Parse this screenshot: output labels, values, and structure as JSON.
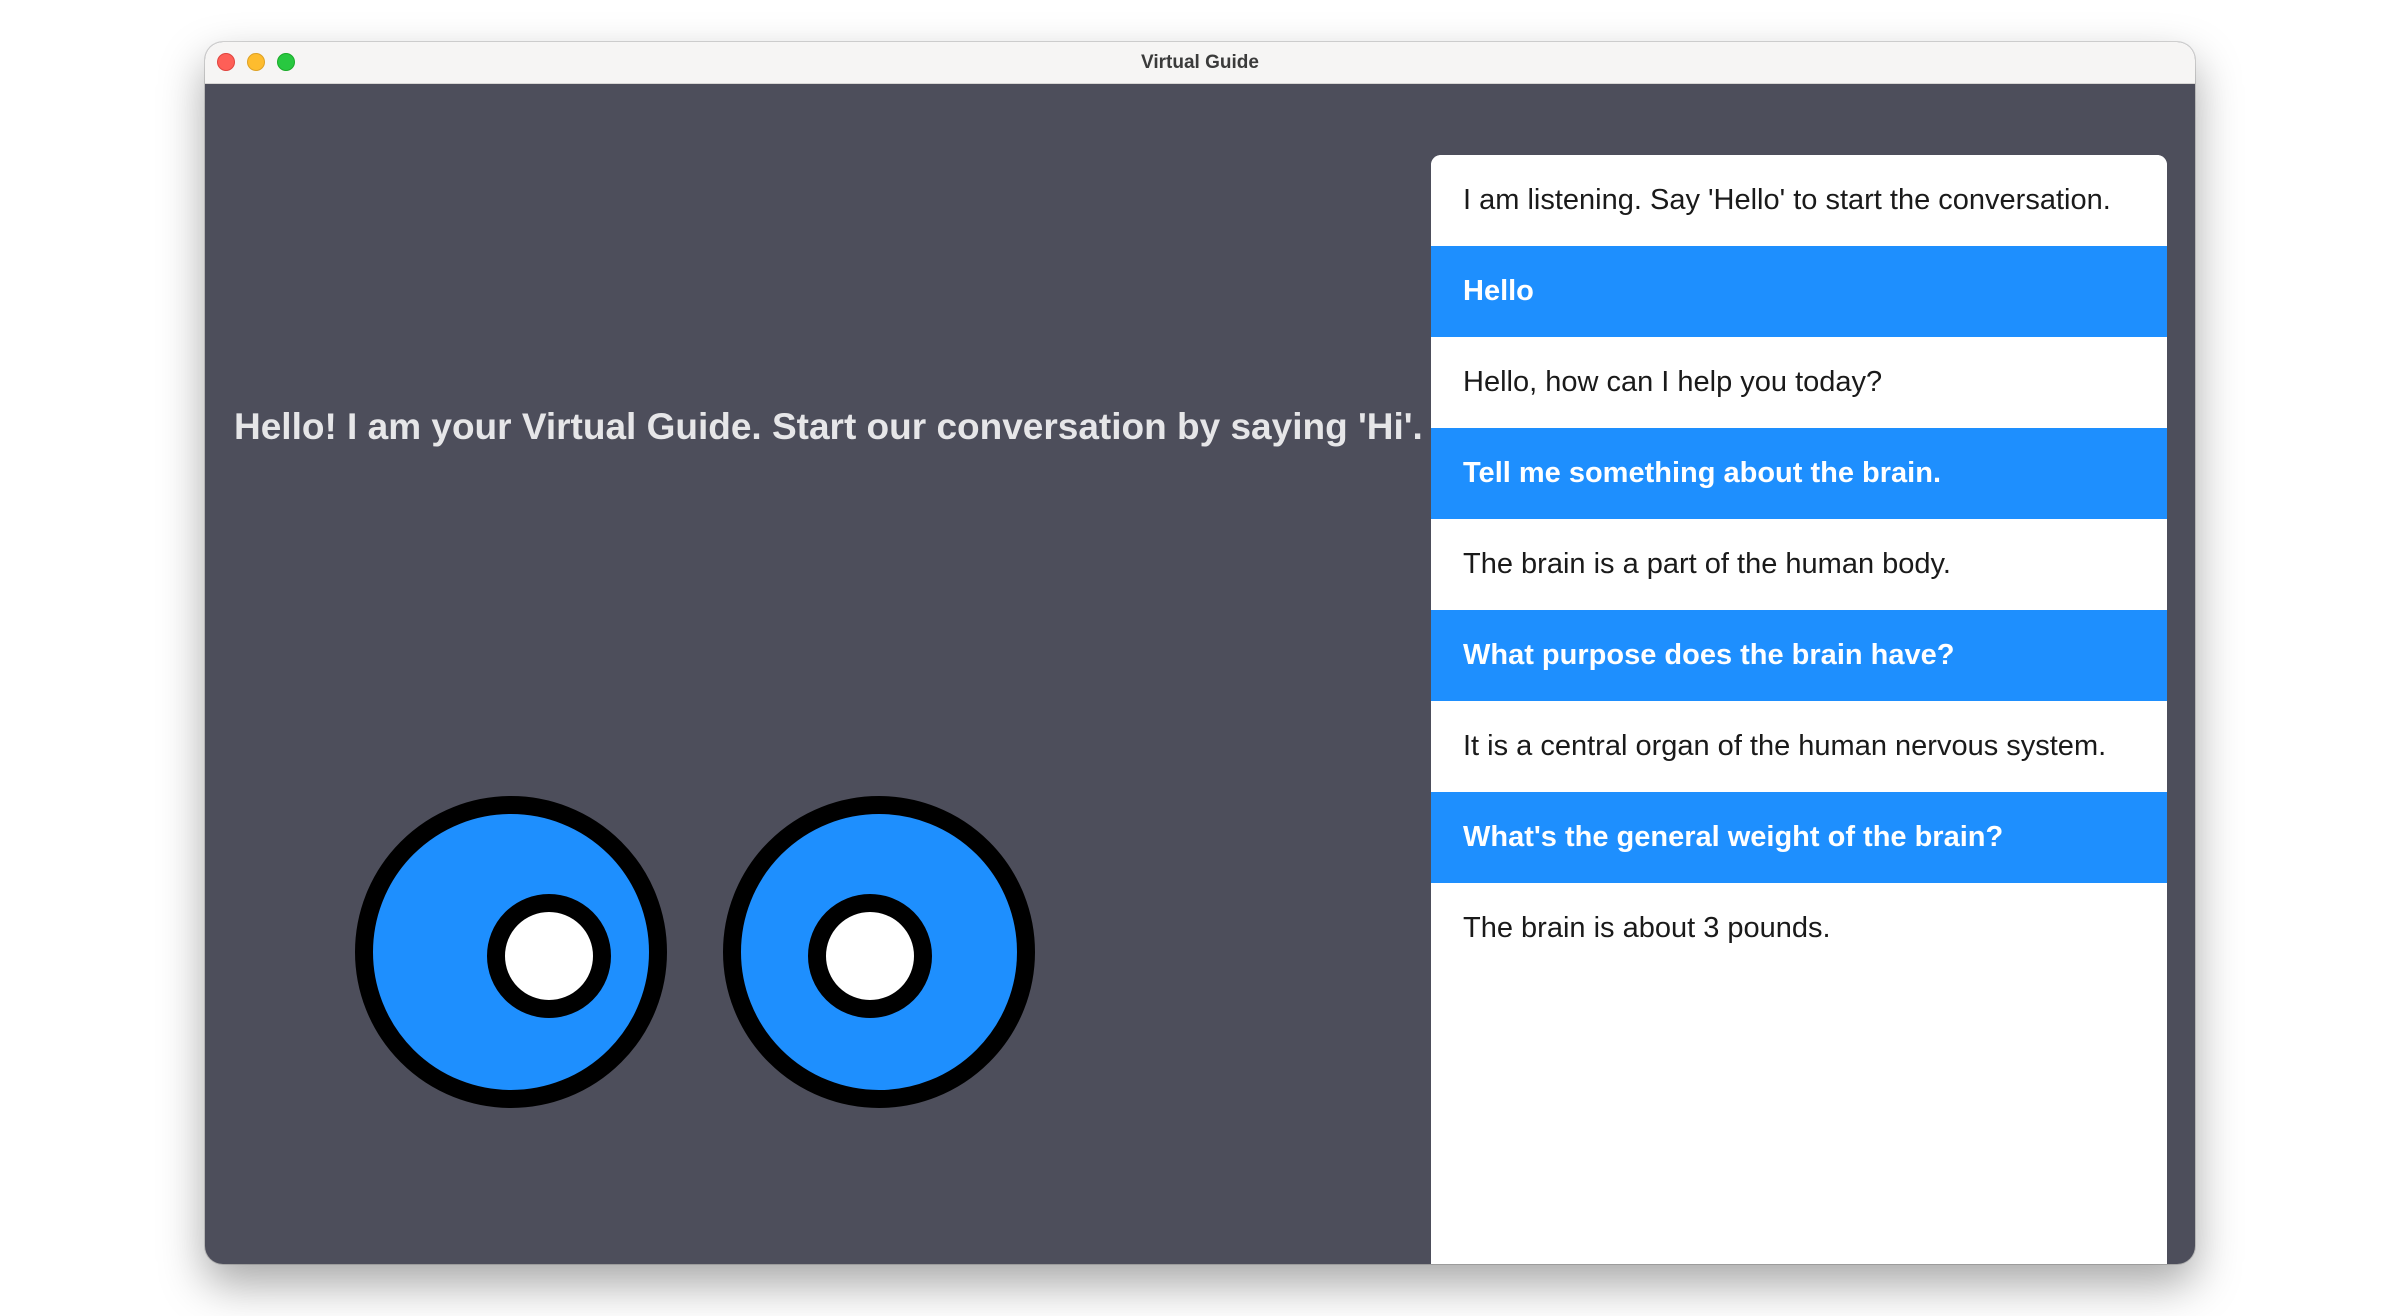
{
  "window": {
    "title": "Virtual Guide"
  },
  "guide": {
    "greeting": "Hello! I am your Virtual Guide. Start our conversation by saying 'Hi'."
  },
  "chat": {
    "messages": [
      {
        "role": "bot",
        "text": "I am listening. Say 'Hello' to start the conversation."
      },
      {
        "role": "user",
        "text": "Hello"
      },
      {
        "role": "bot",
        "text": "Hello, how can I help you today?"
      },
      {
        "role": "user",
        "text": "Tell me something about the brain."
      },
      {
        "role": "bot",
        "text": "The brain is a part of the human body."
      },
      {
        "role": "user",
        "text": "What purpose does the brain have?"
      },
      {
        "role": "bot",
        "text": "It is a central organ of the human nervous system."
      },
      {
        "role": "user",
        "text": "What's the general weight of the brain?"
      },
      {
        "role": "bot",
        "text": "The brain is about 3 pounds."
      }
    ]
  },
  "colors": {
    "background": "#4d4e5b",
    "accent": "#1e8ffe",
    "eye_outline": "#000000",
    "pupil": "#ffffff"
  }
}
